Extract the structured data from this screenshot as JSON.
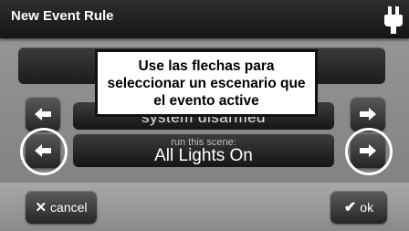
{
  "window": {
    "title": "New Event Rule"
  },
  "event_field": {
    "value": "system disarmed"
  },
  "scene_field": {
    "label": "run this scene:",
    "value": "All Lights On"
  },
  "callout": {
    "text": "Use las flechas para seleccionar un escenario que el evento active"
  },
  "buttons": {
    "cancel_label": "cancel",
    "ok_label": "ok"
  },
  "icons": {
    "plug": "power-plug-icon",
    "left": "arrow-left-icon",
    "right": "arrow-right-icon",
    "cancel": "x-icon",
    "ok": "checkmark-icon"
  },
  "colors": {
    "title_bar": "#1c1c1c",
    "callout_bg": "#ffffff",
    "highlight_ring": "#ffffff"
  }
}
